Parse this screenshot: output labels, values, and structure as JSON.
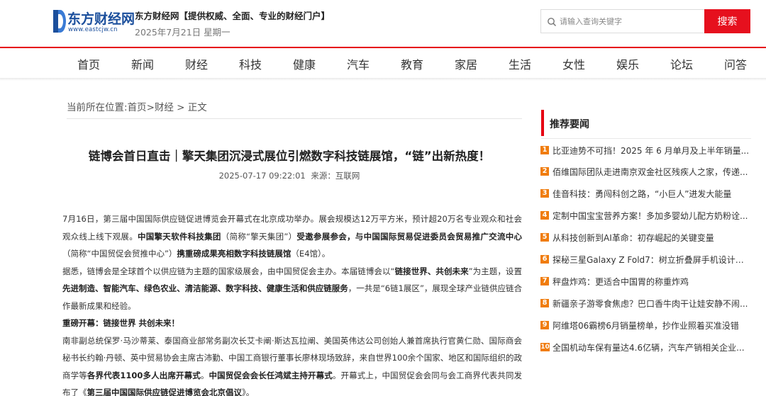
{
  "header": {
    "logo_name": "东方财经网",
    "logo_url": "www.eastcjw.cn",
    "slogan": "东方财经网【提供权威、全面、专业的财经门户】",
    "date": "2025年7月21日 星期一",
    "search_placeholder": "请输入查询关键字",
    "search_button": "搜索",
    "brand_color": "#e60012",
    "logo_color": "#1b4f9c"
  },
  "nav": {
    "items": [
      "首页",
      "新闻",
      "财经",
      "科技",
      "健康",
      "汽车",
      "教育",
      "家居",
      "生活",
      "女性",
      "娱乐",
      "论坛",
      "问答"
    ]
  },
  "breadcrumb": {
    "prefix": "当前所在位置:",
    "home": "首页",
    "sep1": ">",
    "category": "财经",
    "sep2": " > ",
    "current": "正文"
  },
  "article": {
    "title": "链博会首日直击｜擎天集团沉浸式展位引燃数字科技链展馆，“链”出新热度！",
    "datetime": "2025-07-17 09:22:01",
    "source_label": "来源：",
    "source": "互联网",
    "p1_a": "7月16日，第三届中国国际供应链促进博览会开幕式在北京成功举办。展会规模达12万平方米，预计超20万名专业观众和社会观众线上线下观展。",
    "p1_b": "中国擎天软件科技集团",
    "p1_c": "（简称“擎天集团”）",
    "p1_d": "受邀参展参会，与中国国际贸易促进委员会贸易推广交流中心",
    "p1_e": "（简称“中国贸促会贸推中心”）",
    "p1_f": "携重磅成果亮相数字科技链展馆",
    "p1_g": "（E4馆）。",
    "p2_a": "据悉，链博会是全球首个以供应链为主题的国家级展会，由中国贸促会主办。本届链博会以“",
    "p2_b": "链接世界、共创未来",
    "p2_c": "”为主题，设置",
    "p2_d": "先进制造、智能汽车、绿色农业、清洁能源、数字科技、健康生活和供应链服务",
    "p2_e": "，一共是“6链1展区”，展现全球产业链供应链合作最新成果和经验。",
    "p3": "重磅开幕：链接世界 共创未来！",
    "p4_a": "南非副总统保罗·马沙蒂莱、泰国商业部常务副次长艾卡阐·斯达瓦拉阐、美国英伟达公司创始人兼首席执行官黄仁勋、国际商会秘书长约翰·丹顿、英中贸易协会主席古沛勤、中国工商银行董事长廖林现场致辞，来自世界100余个国家、地区和国际组织的政商学等",
    "p4_b": "各界代表1100多人出席开幕式",
    "p4_c": "。",
    "p4_d": "中国贸促会会长任鸿斌主持开幕式",
    "p4_e": "。开幕式上，中国贸促会会同与会工商界代表共同发布了《",
    "p4_f": "第三届中国国际供应链促进博览会北京倡议",
    "p4_g": "》。"
  },
  "sidebar": {
    "title": "推荐要闻",
    "items": [
      {
        "num": "1",
        "text": "比亚迪势不可挡！2025 年 6 月单月及上半年销量..."
      },
      {
        "num": "2",
        "text": "佰维国际团队走进南京双金社区残疾人之家，传递..."
      },
      {
        "num": "3",
        "text": "佳音科技：勇闯科创之路，“小巨人”进发大能量"
      },
      {
        "num": "4",
        "text": "定制中国宝宝营养方案！多加多婴幼儿配方奶粉诠..."
      },
      {
        "num": "5",
        "text": "从科技创新到AI革命：初存崛起的关键变量"
      },
      {
        "num": "6",
        "text": "探秘三星Galaxy Z Fold7：树立折叠屏手机设计新..."
      },
      {
        "num": "7",
        "text": "秤盘炸鸡：更适合中国胃的称重炸鸡"
      },
      {
        "num": "8",
        "text": "新疆亲子游零食焦虑？巴口香牛肉干让娃安静不闹..."
      },
      {
        "num": "9",
        "text": "阿维塔06霸榜6月销量榜单，抄作业照着买准没错"
      },
      {
        "num": "10",
        "text": "全国机动车保有量达4.6亿辆，汽车产销相关企业..."
      }
    ],
    "badge_color": "#f07c0d"
  }
}
